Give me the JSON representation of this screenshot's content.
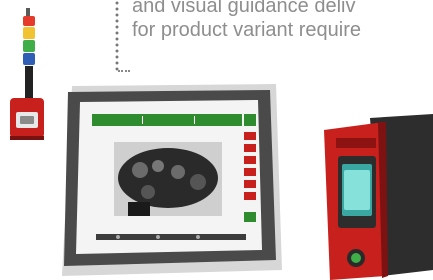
{
  "intro_text": {
    "line_1": "and visual guidance deliv",
    "line_2": "for product variant require"
  },
  "products": {
    "stack_light_scanner": {
      "image_label": "stack-light-scanner-image"
    },
    "touchscreen_hmi": {
      "screen_header_left": "",
      "screen_header_right": ""
    },
    "handheld_terminal": {
      "image_label": "handheld-terminal-image"
    }
  },
  "colors": {
    "text": "#8e8e8e",
    "accent_green": "#2e8b2e",
    "device_red": "#c8201c",
    "hmi_frame": "#d7d7d7"
  }
}
